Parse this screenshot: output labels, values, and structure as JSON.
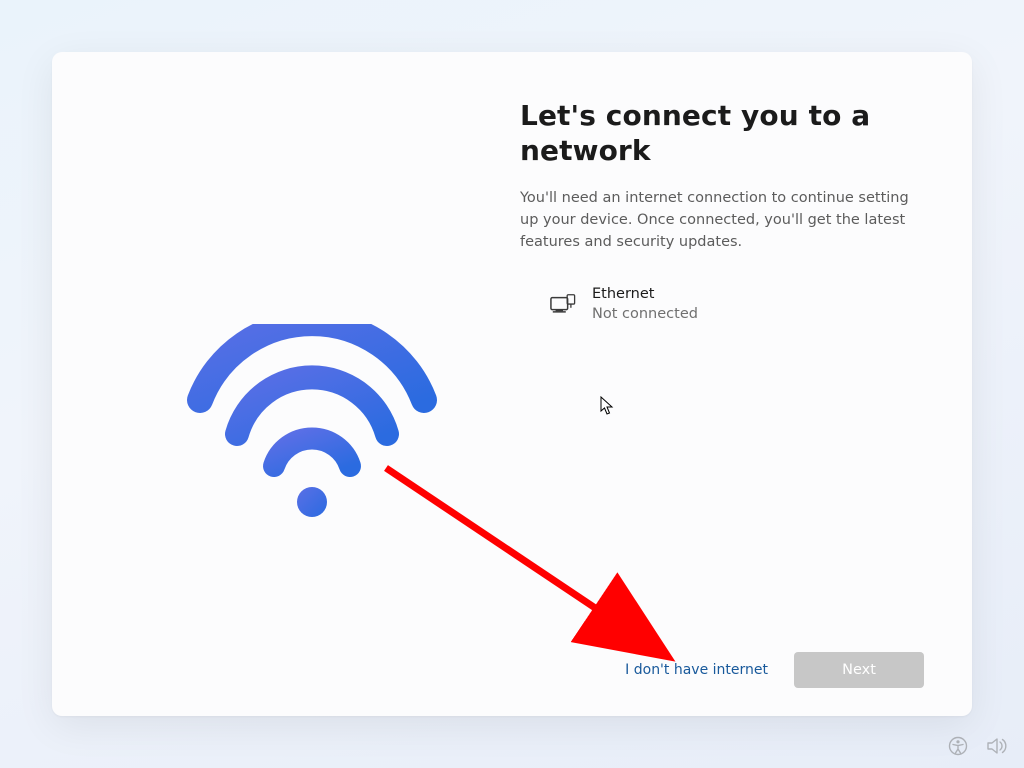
{
  "heading": "Let's connect you to a network",
  "body": "You'll need an internet connection to continue setting up your device. Once connected, you'll get the latest features and security updates.",
  "network": {
    "name": "Ethernet",
    "status": "Not connected"
  },
  "footer": {
    "no_internet_link": "I don't have internet",
    "next_label": "Next"
  }
}
